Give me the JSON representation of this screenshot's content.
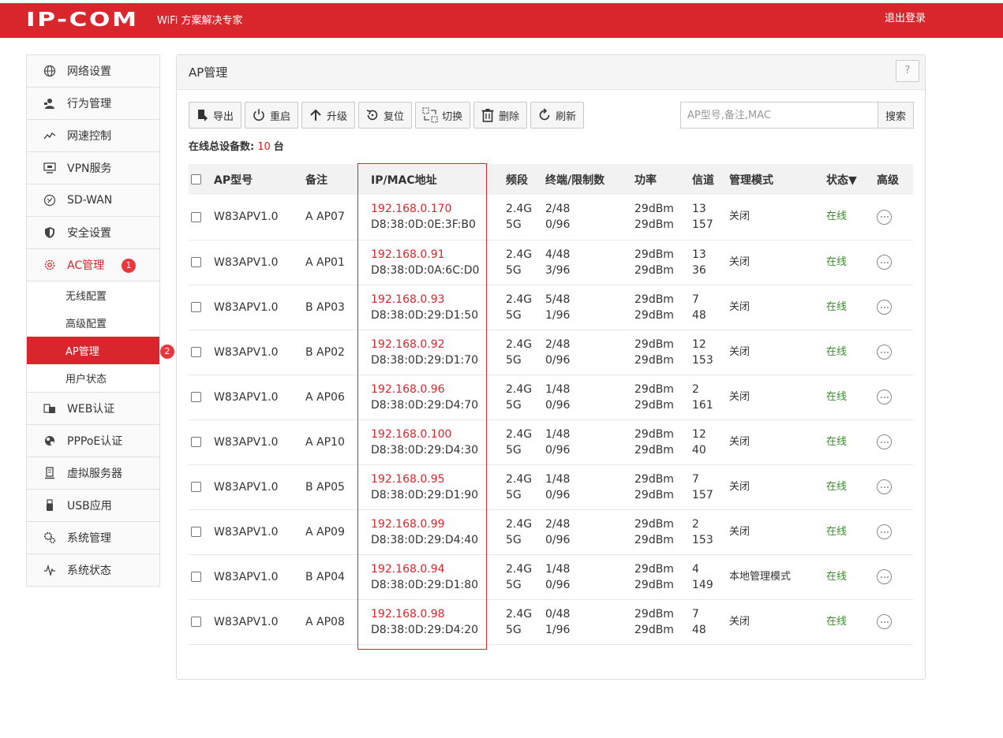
{
  "header": {
    "logo": "IP-COM",
    "tagline": "WiFi 方案解决专家",
    "logout": "退出登录"
  },
  "sidebar": {
    "items": [
      {
        "label": "网络设置",
        "icon": "globe-icon"
      },
      {
        "label": "行为管理",
        "icon": "user-manage-icon"
      },
      {
        "label": "网速控制",
        "icon": "speed-chart-icon"
      },
      {
        "label": "VPN服务",
        "icon": "vpn-icon"
      },
      {
        "label": "SD-WAN",
        "icon": "sdwan-icon"
      },
      {
        "label": "安全设置",
        "icon": "shield-icon"
      },
      {
        "label": "AC管理",
        "icon": "ac-gear-icon",
        "badge": "1"
      }
    ],
    "ac_sub_items": [
      {
        "label": "无线配置"
      },
      {
        "label": "高级配置"
      },
      {
        "label": "AP管理",
        "badge": "2"
      },
      {
        "label": "用户状态"
      }
    ],
    "items_after": [
      {
        "label": "WEB认证",
        "icon": "web-auth-icon"
      },
      {
        "label": "PPPoE认证",
        "icon": "pppoe-icon"
      },
      {
        "label": "虚拟服务器",
        "icon": "server-icon"
      },
      {
        "label": "USB应用",
        "icon": "usb-icon"
      },
      {
        "label": "系统管理",
        "icon": "gears-icon"
      },
      {
        "label": "系统状态",
        "icon": "pulse-icon"
      }
    ]
  },
  "panel": {
    "title": "AP管理",
    "help": "?"
  },
  "toolbar": {
    "buttons": [
      {
        "label": "导出",
        "icon": "export-icon"
      },
      {
        "label": "重启",
        "icon": "power-icon"
      },
      {
        "label": "升级",
        "icon": "arrow-up-icon"
      },
      {
        "label": "复位",
        "icon": "reset-icon"
      },
      {
        "label": "切换",
        "icon": "switch-icon"
      },
      {
        "label": "删除",
        "icon": "trash-icon"
      },
      {
        "label": "刷新",
        "icon": "refresh-icon"
      }
    ],
    "search_placeholder": "AP型号,备注,MAC",
    "search_button": "搜索"
  },
  "summary": {
    "label": "在线总设备数:",
    "count": "10",
    "unit": "台"
  },
  "table": {
    "headers": [
      "AP型号",
      "备注",
      "IP/MAC地址",
      "频段",
      "终端/限制数",
      "功率",
      "信道",
      "管理模式",
      "状态▼",
      "高级"
    ],
    "rows": [
      {
        "model": "W83APV1.0",
        "note": "A AP07",
        "ip": "192.168.0.170",
        "mac": "D8:38:0D:0E:3F:B0",
        "band1": "2.4G",
        "band2": "5G",
        "term1": "2/48",
        "term2": "0/96",
        "pow1": "29dBm",
        "pow2": "29dBm",
        "ch1": "13",
        "ch2": "157",
        "mode": "关闭",
        "status": "在线"
      },
      {
        "model": "W83APV1.0",
        "note": "A AP01",
        "ip": "192.168.0.91",
        "mac": "D8:38:0D:0A:6C:D0",
        "band1": "2.4G",
        "band2": "5G",
        "term1": "4/48",
        "term2": "3/96",
        "pow1": "29dBm",
        "pow2": "29dBm",
        "ch1": "13",
        "ch2": "36",
        "mode": "关闭",
        "status": "在线"
      },
      {
        "model": "W83APV1.0",
        "note": "B AP03",
        "ip": "192.168.0.93",
        "mac": "D8:38:0D:29:D1:50",
        "band1": "2.4G",
        "band2": "5G",
        "term1": "5/48",
        "term2": "1/96",
        "pow1": "29dBm",
        "pow2": "29dBm",
        "ch1": "7",
        "ch2": "48",
        "mode": "关闭",
        "status": "在线"
      },
      {
        "model": "W83APV1.0",
        "note": "B AP02",
        "ip": "192.168.0.92",
        "mac": "D8:38:0D:29:D1:70",
        "band1": "2.4G",
        "band2": "5G",
        "term1": "2/48",
        "term2": "0/96",
        "pow1": "29dBm",
        "pow2": "29dBm",
        "ch1": "12",
        "ch2": "153",
        "mode": "关闭",
        "status": "在线"
      },
      {
        "model": "W83APV1.0",
        "note": "A AP06",
        "ip": "192.168.0.96",
        "mac": "D8:38:0D:29:D4:70",
        "band1": "2.4G",
        "band2": "5G",
        "term1": "1/48",
        "term2": "0/96",
        "pow1": "29dBm",
        "pow2": "29dBm",
        "ch1": "2",
        "ch2": "161",
        "mode": "关闭",
        "status": "在线"
      },
      {
        "model": "W83APV1.0",
        "note": "A AP10",
        "ip": "192.168.0.100",
        "mac": "D8:38:0D:29:D4:30",
        "band1": "2.4G",
        "band2": "5G",
        "term1": "1/48",
        "term2": "0/96",
        "pow1": "29dBm",
        "pow2": "29dBm",
        "ch1": "12",
        "ch2": "40",
        "mode": "关闭",
        "status": "在线"
      },
      {
        "model": "W83APV1.0",
        "note": "B AP05",
        "ip": "192.168.0.95",
        "mac": "D8:38:0D:29:D1:90",
        "band1": "2.4G",
        "band2": "5G",
        "term1": "1/48",
        "term2": "0/96",
        "pow1": "29dBm",
        "pow2": "29dBm",
        "ch1": "7",
        "ch2": "157",
        "mode": "关闭",
        "status": "在线"
      },
      {
        "model": "W83APV1.0",
        "note": "A AP09",
        "ip": "192.168.0.99",
        "mac": "D8:38:0D:29:D4:40",
        "band1": "2.4G",
        "band2": "5G",
        "term1": "2/48",
        "term2": "0/96",
        "pow1": "29dBm",
        "pow2": "29dBm",
        "ch1": "2",
        "ch2": "153",
        "mode": "关闭",
        "status": "在线"
      },
      {
        "model": "W83APV1.0",
        "note": "B AP04",
        "ip": "192.168.0.94",
        "mac": "D8:38:0D:29:D1:80",
        "band1": "2.4G",
        "band2": "5G",
        "term1": "1/48",
        "term2": "0/96",
        "pow1": "29dBm",
        "pow2": "29dBm",
        "ch1": "4",
        "ch2": "149",
        "mode": "本地管理模式",
        "status": "在线"
      },
      {
        "model": "W83APV1.0",
        "note": "A AP08",
        "ip": "192.168.0.98",
        "mac": "D8:38:0D:29:D4:20",
        "band1": "2.4G",
        "band2": "5G",
        "term1": "0/48",
        "term2": "1/96",
        "pow1": "29dBm",
        "pow2": "29dBm",
        "ch1": "7",
        "ch2": "48",
        "mode": "关闭",
        "status": "在线"
      }
    ]
  },
  "colors": {
    "brand_red": "#d9262c",
    "online_green": "#3a8a2c"
  }
}
